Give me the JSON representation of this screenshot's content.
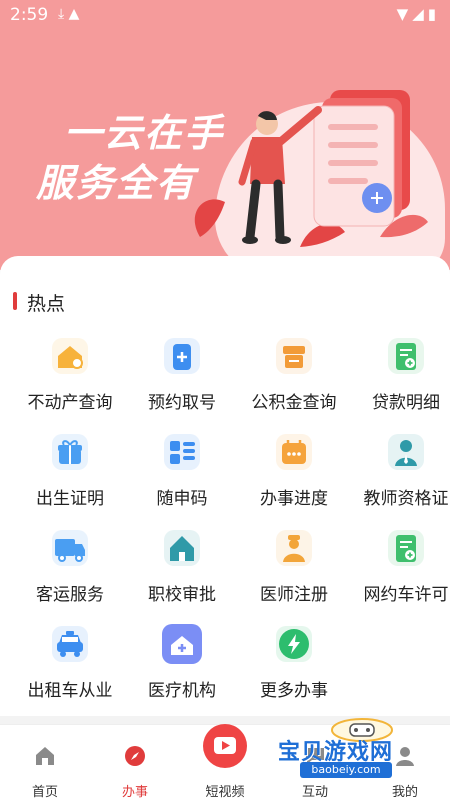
{
  "status_bar": {
    "time": "2:59",
    "left_icons": "⤓ ▲",
    "right_icons": "▼◢▮"
  },
  "banner": {
    "line1": "一云在手",
    "line2": "服务全有"
  },
  "section": {
    "title": "热点"
  },
  "services": [
    {
      "label": "不动产查询",
      "icon": "house-search-icon",
      "color": "#f7b23b"
    },
    {
      "label": "预约取号",
      "icon": "queue-ticket-icon",
      "color": "#3d8ef0"
    },
    {
      "label": "公积金查询",
      "icon": "fund-icon",
      "color": "#f29b38"
    },
    {
      "label": "贷款明细",
      "icon": "loan-doc-icon",
      "color": "#3fbf6d"
    },
    {
      "label": "出生证明",
      "icon": "birth-gift-icon",
      "color": "#4a9ef2"
    },
    {
      "label": "随申码",
      "icon": "qr-grid-icon",
      "color": "#3d8ef0"
    },
    {
      "label": "办事进度",
      "icon": "calendar-progress-icon",
      "color": "#f5a33c"
    },
    {
      "label": "教师资格证",
      "icon": "teacher-icon",
      "color": "#2f9aa8"
    },
    {
      "label": "客运服务",
      "icon": "truck-icon",
      "color": "#4a9ef2"
    },
    {
      "label": "职校审批",
      "icon": "school-building-icon",
      "color": "#2f9aa8"
    },
    {
      "label": "医师注册",
      "icon": "doctor-icon",
      "color": "#f2a53a"
    },
    {
      "label": "网约车许可",
      "icon": "permit-doc-icon",
      "color": "#3fbf6d"
    },
    {
      "label": "出租车从业",
      "icon": "taxi-icon",
      "color": "#3d8ef0"
    },
    {
      "label": "医疗机构",
      "icon": "hospital-icon",
      "color": "#7b8ef5"
    },
    {
      "label": "更多办事",
      "icon": "lightning-icon",
      "color": "#2dbd6e"
    }
  ],
  "tabs": [
    {
      "label": "首页",
      "icon": "home-icon",
      "active": false
    },
    {
      "label": "办事",
      "icon": "compass-icon",
      "active": true
    },
    {
      "label": "短视频",
      "icon": "play-icon",
      "active": false
    },
    {
      "label": "互动",
      "icon": "chat-icon",
      "active": false
    },
    {
      "label": "我的",
      "icon": "user-icon",
      "active": false
    }
  ],
  "watermark": {
    "title": "宝贝游戏网",
    "url": "baobeiy.com"
  },
  "colors": {
    "accent": "#e03c3c",
    "banner": "#f59b9b"
  }
}
